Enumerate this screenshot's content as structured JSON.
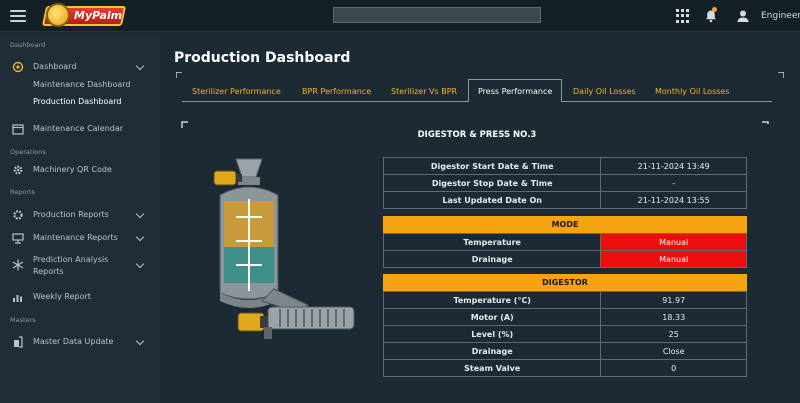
{
  "app": {
    "logo_text": "MyPalm",
    "user_name": "Engineer"
  },
  "sidebar": {
    "sections": [
      "Dashboard",
      "Operations",
      "Reports",
      "Masters"
    ],
    "dashboard": {
      "label": "Dashboard",
      "sub": [
        "Maintenance Dashboard",
        "Production Dashboard"
      ]
    },
    "maintenance_calendar": "Maintenance Calendar",
    "machinery_qr": "Machinery QR Code",
    "production_reports": "Production Reports",
    "maintenance_reports": "Maintenance Reports",
    "prediction_line1": "Prediction Analysis",
    "prediction_line2": "Reports",
    "weekly_report": "Weekly Report",
    "master_data": "Master Data Update"
  },
  "main": {
    "title": "Production Dashboard",
    "tabs": [
      {
        "label": "Sterilizer Performance"
      },
      {
        "label": "BPR Performance"
      },
      {
        "label": "Sterilizer Vs BPR"
      },
      {
        "label": "Press Performance"
      },
      {
        "label": "Daily Oil Losses"
      },
      {
        "label": "Monthly Oil Losses"
      }
    ],
    "panel_title": "DIGESTOR & PRESS NO.3",
    "times": [
      {
        "label": "Digestor Start Date & Time",
        "value": "21-11-2024 13:49"
      },
      {
        "label": "Digestor Stop Date & Time",
        "value": "-"
      },
      {
        "label": "Last Updated Date On",
        "value": "21-11-2024 13:55"
      }
    ],
    "mode_header": "MODE",
    "mode": [
      {
        "label": "Temperature",
        "value": "Manual"
      },
      {
        "label": "Drainage",
        "value": "Manual"
      }
    ],
    "digestor_header": "DIGESTOR",
    "digestor": [
      {
        "label": "Temperature (°C)",
        "value": "91.97"
      },
      {
        "label": "Motor (A)",
        "value": "18.33"
      },
      {
        "label": "Level (%)",
        "value": "25"
      },
      {
        "label": "Drainage",
        "value": "Close"
      },
      {
        "label": "Steam Valve",
        "value": "0"
      }
    ]
  },
  "colors": {
    "accent": "#f5a40f",
    "alert": "#ee0d0d",
    "background": "#1b2a33",
    "tab_text": "#f0b323"
  },
  "icons": [
    "menu-icon",
    "apps-grid-icon",
    "bell-icon",
    "user-icon",
    "dashboard-icon",
    "calendar-icon",
    "gear-icon",
    "reports-gear-icon",
    "maintenance-icon",
    "snowflake-icon",
    "chart-icon",
    "master-data-icon"
  ]
}
